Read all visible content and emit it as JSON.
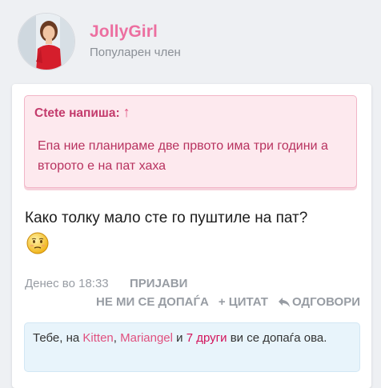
{
  "author": {
    "username": "JollyGirl",
    "title": "Популарен член"
  },
  "quote": {
    "header": "Ctete напиша:",
    "arrow": "↑",
    "body": "Епа ние планираме две првото има три години а второто е на пат хаха"
  },
  "post": {
    "text": "Како толку мало сте го пуштиле на пат?",
    "emoji": "embarrassed-face"
  },
  "meta": {
    "date": "Денес во 18:33",
    "report": "ПРИЈАВИ",
    "dislike": "НЕ МИ СЕ ДОПАЃА",
    "quote": "+ ЦИТАТ",
    "reply": "ОДГОВОРИ"
  },
  "likes": {
    "prefix": "Тебе, на",
    "user1": "Kitten",
    "sep1": ",",
    "user2": "Mariangel",
    "and": "и",
    "others": "7 други",
    "suffix": "ви се допаѓа ова."
  },
  "colors": {
    "accent": "#ec6fa0",
    "quote_bg": "#fde9ee",
    "likes_bg": "#e8f4fb"
  }
}
